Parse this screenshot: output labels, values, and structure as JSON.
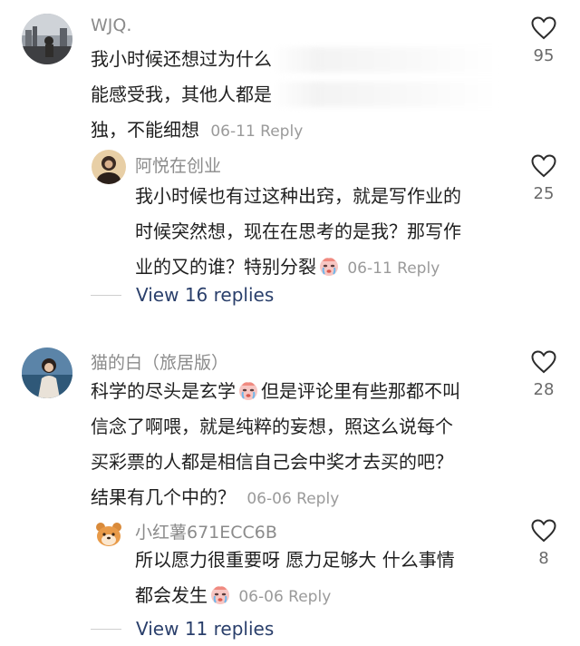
{
  "comments": [
    {
      "username": "WJQ.",
      "lines": [
        "我小时候还想过为什么",
        "能感受我，其他人都是",
        "独，不能细想"
      ],
      "date": "06-11",
      "reply_label": "Reply",
      "likes": "95",
      "reply": {
        "username": "阿悦在创业",
        "lines": [
          "我小时候也有过这种出窍，就是写作业的",
          "时候突然想，现在在思考的是我？那写作",
          "业的又的谁？特别分裂"
        ],
        "date": "06-11",
        "reply_label": "Reply",
        "likes": "25"
      },
      "view_replies": "View 16 replies"
    },
    {
      "username": "猫的白（旅居版）",
      "lines": [
        "科学的尽头是玄学",
        "但是评论里有些那都不叫",
        "信念了啊喂，就是纯粹的妄想，照这么说每个",
        "买彩票的人都是相信自己会中奖才去买的吧？",
        "结果有几个中的？"
      ],
      "date": "06-06",
      "reply_label": "Reply",
      "likes": "28",
      "reply": {
        "username": "小红薯671ECC6B",
        "lines": [
          "所以愿力很重要呀 愿力足够大 什么事情",
          "都会发生"
        ],
        "date": "06-06",
        "reply_label": "Reply",
        "likes": "8"
      },
      "view_replies": "View 11 replies"
    }
  ]
}
